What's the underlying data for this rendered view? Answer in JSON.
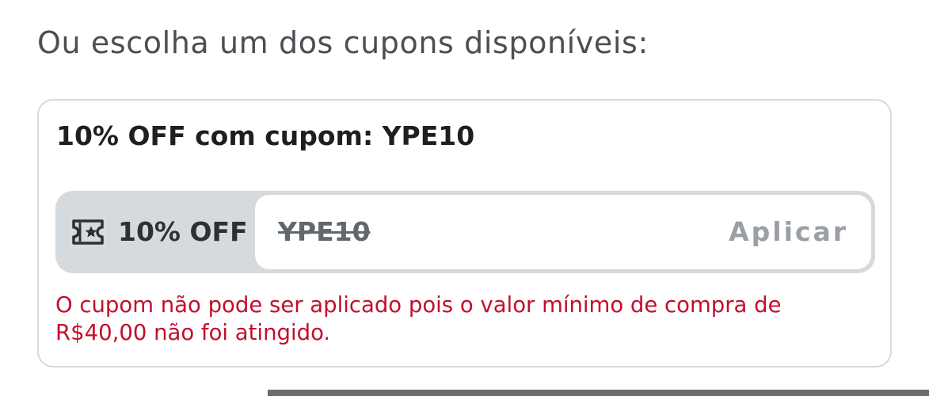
{
  "section": {
    "heading": "Ou escolha um dos cupons disponíveis:"
  },
  "coupon": {
    "title": "10% OFF com cupom: YPE10",
    "discount_label": "10% OFF",
    "discount_icon": "ticket-star-icon",
    "code": "YPE10",
    "code_struck_through": true,
    "apply_label": "Aplicar",
    "apply_enabled": false,
    "error_message": "O cupom não pode ser aplicado pois o valor mínimo de compra de R$40,00 não foi atingido."
  },
  "colors": {
    "heading_text": "#4b4f54",
    "title_text": "#1f1f1f",
    "card_border": "#d4dadf",
    "pill_background": "#d5dadf",
    "pill_text": "#2c3135",
    "code_text": "#60676d",
    "apply_disabled": "#999fa4",
    "error": "#c1102d",
    "background": "#ffffff"
  }
}
